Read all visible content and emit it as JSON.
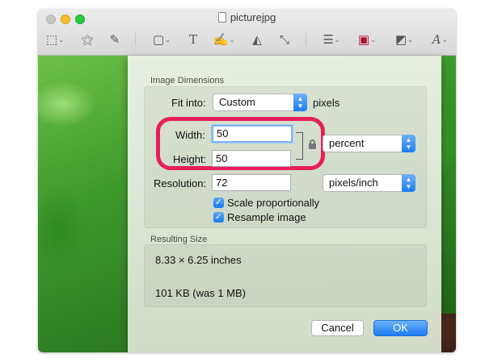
{
  "window": {
    "title": "picturejpg"
  },
  "toolbar": {
    "items": [
      {
        "name": "rect-selection-icon",
        "glyph": "⬚"
      },
      {
        "name": "instant-alpha-icon",
        "glyph": "⚝"
      },
      {
        "name": "sketch-icon",
        "glyph": "✎"
      },
      {
        "name": "shapes-icon",
        "glyph": "▢"
      },
      {
        "name": "text-icon",
        "glyph": "T"
      },
      {
        "name": "sign-icon",
        "glyph": "✍"
      },
      {
        "name": "adjust-color-icon",
        "glyph": "◭"
      },
      {
        "name": "adjust-size-icon",
        "glyph": "⤡"
      },
      {
        "name": "shape-style-icon",
        "glyph": "☰"
      },
      {
        "name": "border-color-icon",
        "glyph": "▣"
      },
      {
        "name": "fill-color-icon",
        "glyph": "◩"
      },
      {
        "name": "text-style-icon",
        "glyph": "A"
      }
    ]
  },
  "dialog": {
    "image_dimensions_title": "Image Dimensions",
    "fit_into_label": "Fit into:",
    "fit_into_value": "Custom",
    "fit_into_unit": "pixels",
    "width_label": "Width:",
    "width_value": "50",
    "height_label": "Height:",
    "height_value": "50",
    "dimension_unit": "percent",
    "resolution_label": "Resolution:",
    "resolution_value": "72",
    "resolution_unit": "pixels/inch",
    "scale_proportionally_label": "Scale proportionally",
    "scale_proportionally_checked": true,
    "resample_label": "Resample image",
    "resample_checked": true,
    "resulting_size_title": "Resulting Size",
    "resulting_dimensions": "8.33 × 6.25 inches",
    "resulting_filesize": "101 KB (was 1 MB)",
    "cancel_label": "Cancel",
    "ok_label": "OK"
  },
  "colors": {
    "highlight": "#e61e5c",
    "accent": "#1c7cf2"
  }
}
